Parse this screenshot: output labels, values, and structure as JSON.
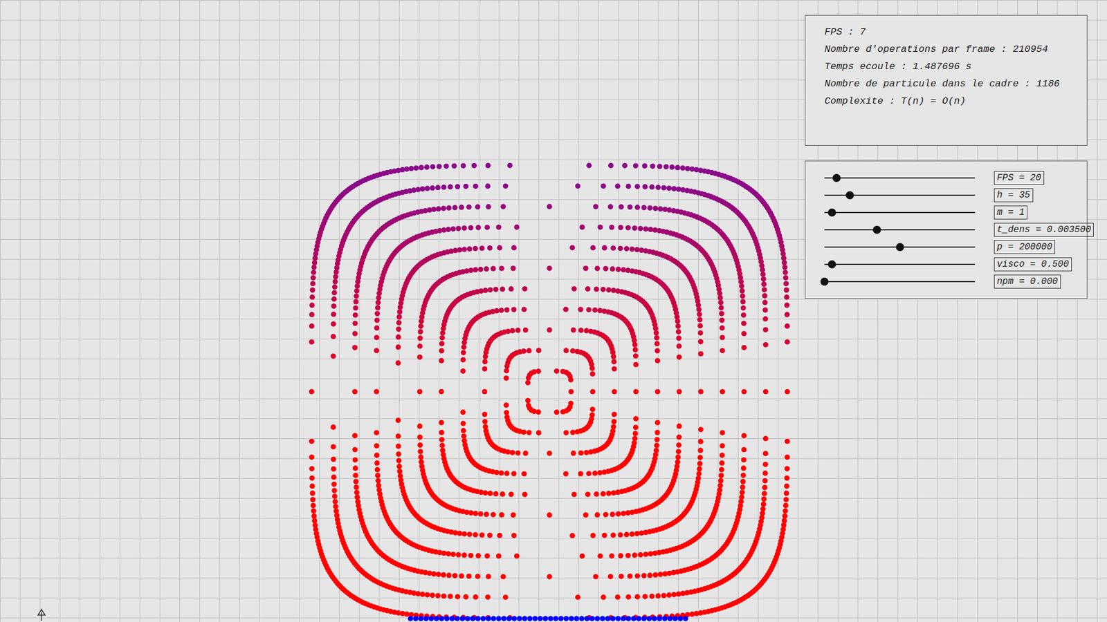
{
  "info": {
    "lines": [
      "FPS : 7",
      "Nombre d'operations par frame : 210954",
      "Temps ecoule : 1.487696 s",
      "Nombre de particule dans le cadre : 1186",
      "Complexite : T(n) = O(n)"
    ]
  },
  "sliders": [
    {
      "label": "FPS = 20",
      "level": 0.08
    },
    {
      "label": "h = 35",
      "level": 0.17
    },
    {
      "label": "m = 1",
      "level": 0.05
    },
    {
      "label": "t_dens = 0.003500",
      "level": 0.35
    },
    {
      "label": "p = 200000",
      "level": 0.5
    },
    {
      "label": "visco = 0.500",
      "level": 0.05
    },
    {
      "label": "npm = 0.000",
      "level": 0.0
    }
  ],
  "fluid": {
    "color_top": "#8a0a8a",
    "color_bottom": "#ff0000",
    "floor_color": "#0000ff"
  }
}
